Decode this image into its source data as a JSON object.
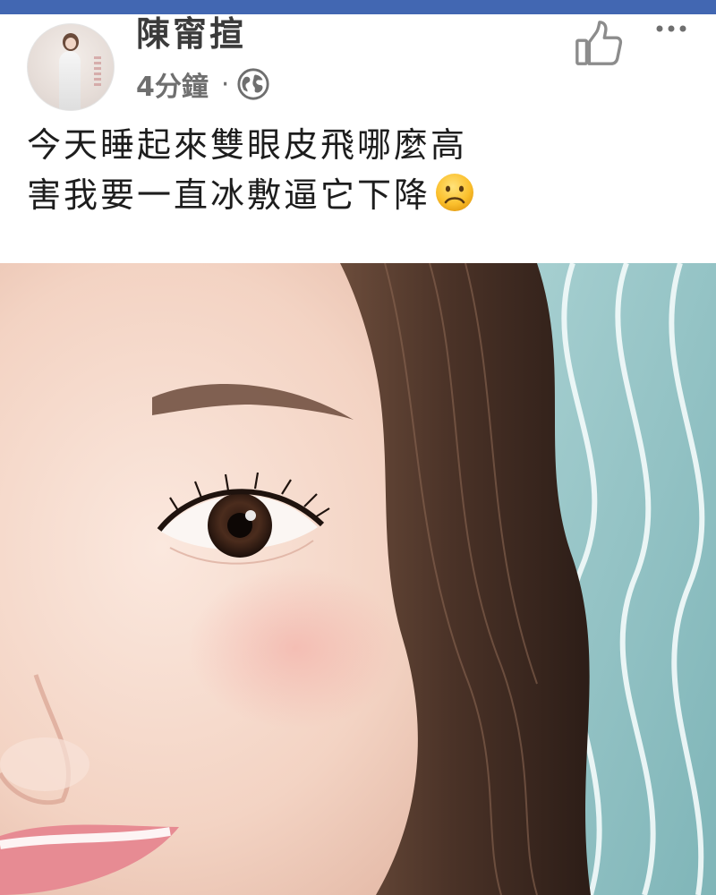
{
  "post": {
    "author_name": "陳甯揎",
    "time": "4分鐘",
    "separator": "·",
    "privacy_icon": "globe-icon",
    "like_icon": "thumbs-up-icon",
    "more_icon": "ellipsis-icon",
    "text_lines": [
      "今天睡起來雙眼皮飛哪麼高",
      "害我要一直冰敷逼它下降"
    ],
    "emoji": "frowning-face"
  },
  "colors": {
    "top_bar": "#4267b2",
    "name": "#3b3b3b",
    "meta": "#6f6f6f",
    "icon": "#8c8c8c",
    "text": "#1d1d1d"
  },
  "photo": {
    "subject": "close-up selfie"
  }
}
